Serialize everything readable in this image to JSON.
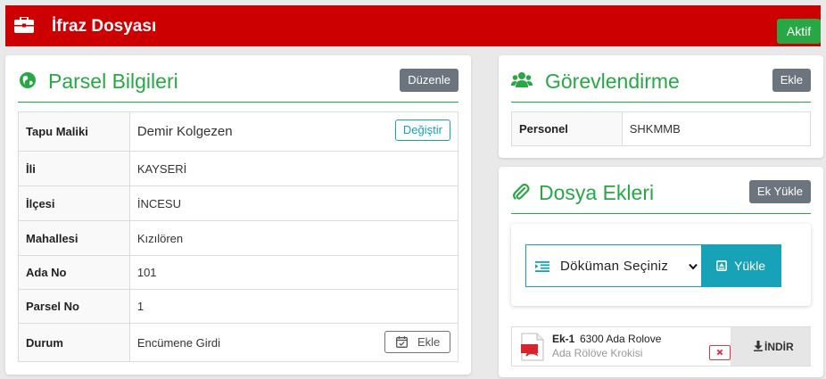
{
  "header": {
    "title": "İfraz Dosyası",
    "status": "Aktif",
    "icon": "briefcase-icon"
  },
  "colors": {
    "header_bg": "#cc0000",
    "accent": "#28a745",
    "info": "#17a2b8",
    "secondary": "#6c757d",
    "danger": "#dc3545"
  },
  "parcel": {
    "title": "Parsel Bilgileri",
    "icon": "globe-icon",
    "edit_label": "Düzenle",
    "change_label": "Değiştir",
    "add_label": "Ekle",
    "rows": [
      {
        "key": "Tapu Maliki",
        "value": "Demir Kolgezen"
      },
      {
        "key": "İli",
        "value": "KAYSERİ"
      },
      {
        "key": "İlçesi",
        "value": "İNCESU"
      },
      {
        "key": "Mahallesi",
        "value": "Kızılören"
      },
      {
        "key": "Ada No",
        "value": "101"
      },
      {
        "key": "Parsel No",
        "value": "1"
      },
      {
        "key": "Durum",
        "value": "Encümene Girdi"
      }
    ]
  },
  "assignment": {
    "title": "Görevlendirme",
    "icon": "users-icon",
    "add_label": "Ekle",
    "rows": [
      {
        "key": "Personel",
        "value": "SHKMMB"
      }
    ]
  },
  "attachments": {
    "title": "Dosya Ekleri",
    "icon": "paperclip-icon",
    "upload_attachment_label": "Ek Yükle",
    "select_value": "Döküman Seçiniz",
    "upload_label": "Yükle",
    "items": [
      {
        "code": "Ek-1",
        "name": "6300 Ada Rolove",
        "description": "Ada Rölöve Krokisi",
        "download_label": "İNDİR"
      }
    ]
  }
}
